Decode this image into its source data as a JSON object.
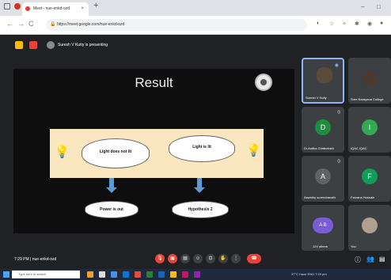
{
  "browser": {
    "tab_title": "Meet - nue-enkd-ozd",
    "tab_close": "×",
    "new_tab": "+",
    "url": "https://meet.google.com/nue-enkd-ozd",
    "minimize": "–",
    "maximize": "□",
    "nav_back": "←",
    "nav_forward": "→",
    "nav_reload": "C",
    "nav_home": "⌂"
  },
  "meet": {
    "presenting_label": "Suresh V Kutty is presenting",
    "slide": {
      "title": "Result",
      "cloud_left": "Light does not lit",
      "cloud_right": "Light is lit",
      "cloud_bottom_left": "Power is out",
      "cloud_bottom_right": "Hypothesis 2"
    },
    "participants": [
      {
        "name": "Suresh V Kutty",
        "initial": "",
        "color": "#5a4a3a"
      },
      {
        "name": "Sree Narayana College",
        "initial": "",
        "color": "#4a3b32"
      },
      {
        "name": "Dr.Anitha Chittezhath",
        "initial": "D",
        "color": "#1e8e3e"
      },
      {
        "name": "IQAC IQAC",
        "initial": "I",
        "color": "#34a853"
      },
      {
        "name": "Aswathy surendranath",
        "initial": "A",
        "color": "#5f6368"
      },
      {
        "name": "Farzana Hussain",
        "initial": "F",
        "color": "#0f9d58"
      },
      {
        "name": "124 others",
        "initial": "A B",
        "color": "#7b5cd6"
      },
      {
        "name": "You",
        "initial": "",
        "color": "#b0a090"
      }
    ],
    "meeting_time": "7:29 PM | nue-enkd-ozd"
  },
  "taskbar": {
    "search_placeholder": "Type here to search",
    "tray": "37°C Haze  ENG  7:29 pm"
  },
  "colors": {
    "meet_bg": "#202124",
    "end_call": "#ea4335",
    "slide_panel": "#fbe7bf",
    "arrow": "#5b9bd5"
  }
}
